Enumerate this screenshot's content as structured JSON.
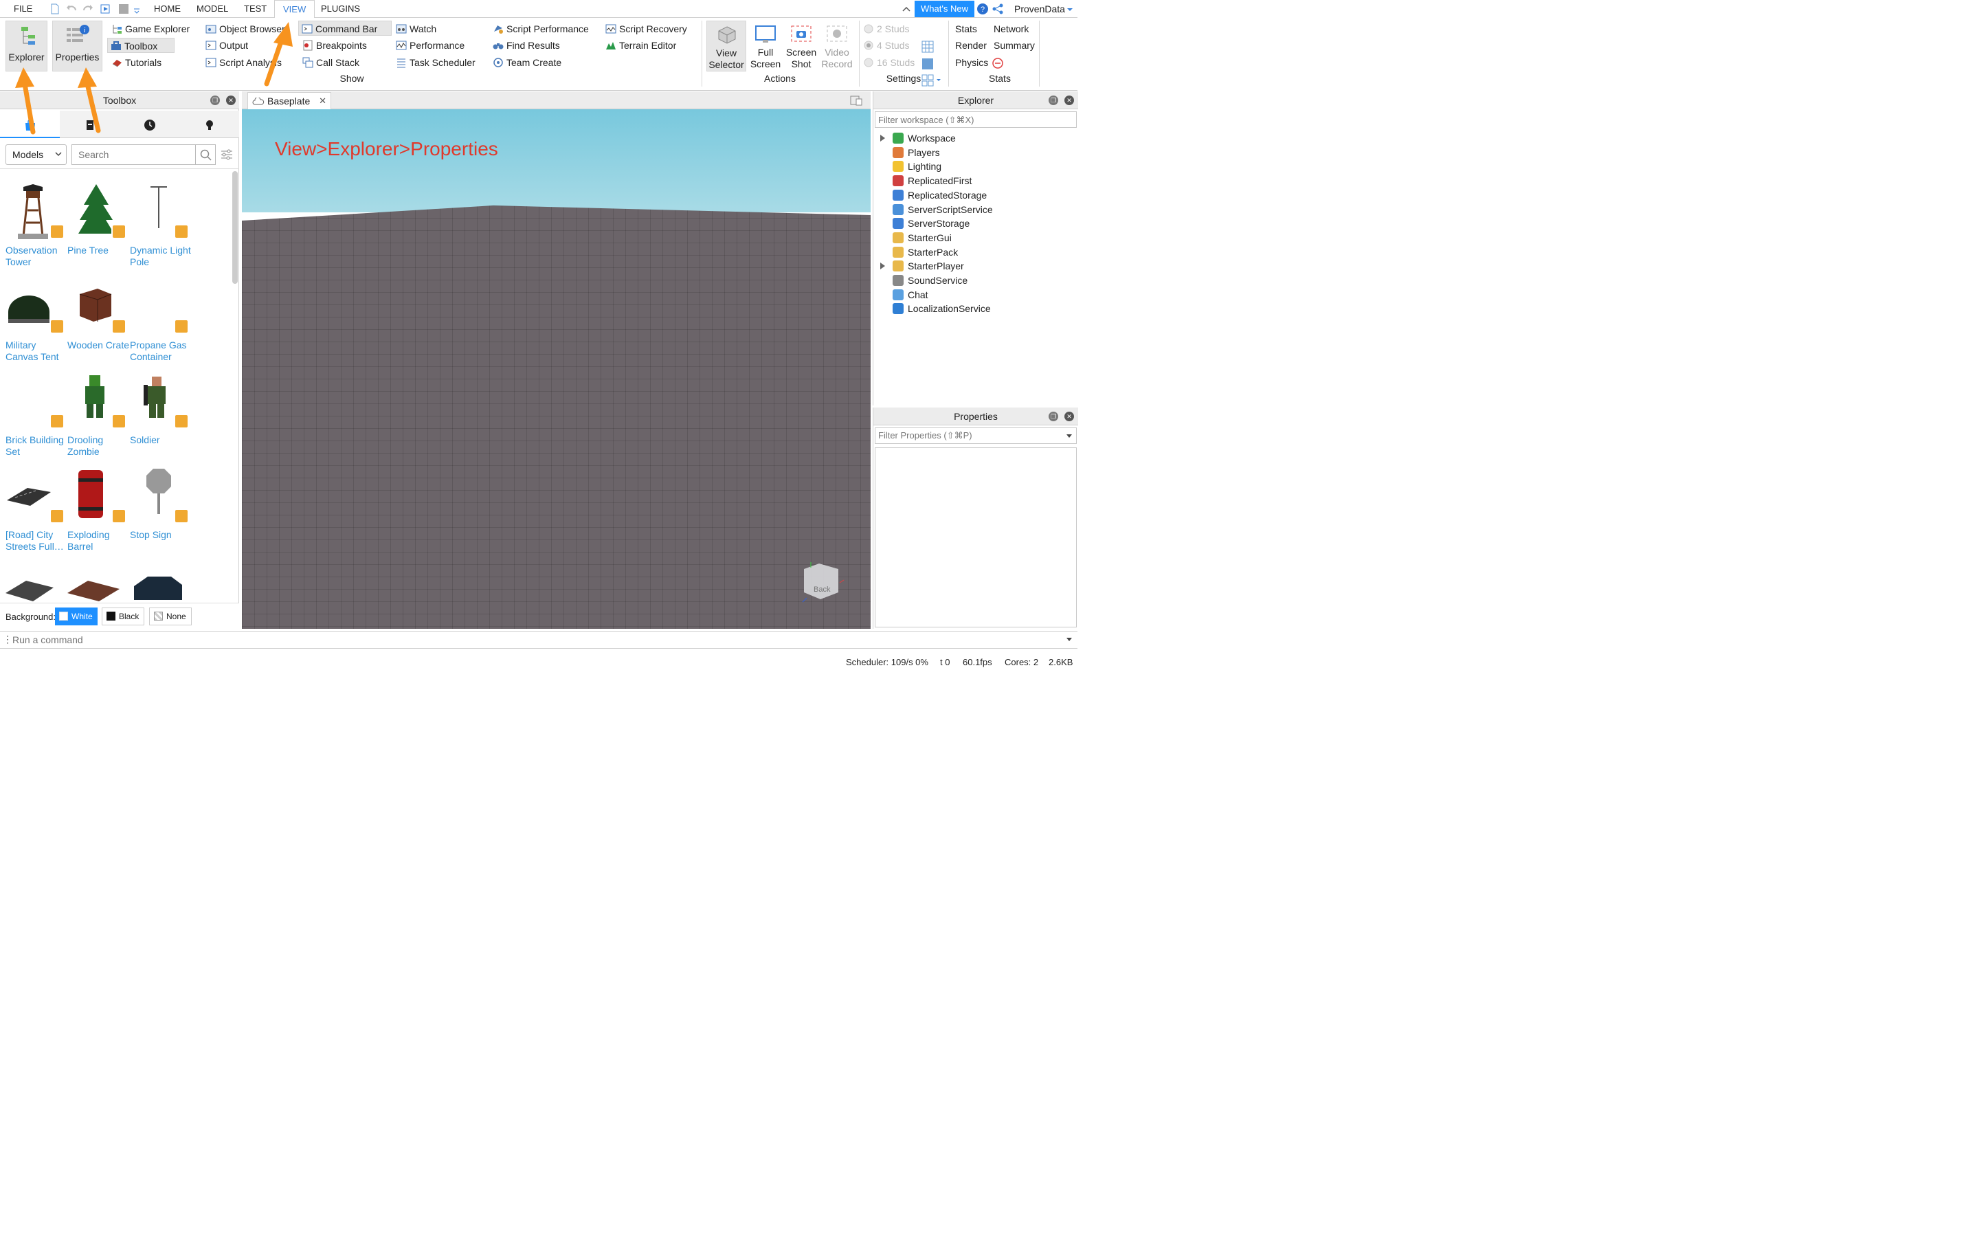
{
  "menubar": {
    "items": [
      "FILE",
      "HOME",
      "MODEL",
      "TEST",
      "VIEW",
      "PLUGINS"
    ],
    "whats_new": "What's New",
    "user": "ProvenData"
  },
  "ribbon": {
    "explorer_btn": "Explorer",
    "properties_btn": "Properties",
    "col1": [
      "Game Explorer",
      "Toolbox",
      "Tutorials"
    ],
    "col2": [
      "Object Browser",
      "Output",
      "Script Analysis"
    ],
    "col3": [
      "Command Bar",
      "Breakpoints",
      "Call Stack"
    ],
    "col4": [
      "Watch",
      "Performance",
      "Task Scheduler"
    ],
    "col5": [
      "Script Performance",
      "Find Results",
      "Team Create"
    ],
    "col6": [
      "Script Recovery",
      "Terrain Editor"
    ],
    "show_label": "Show",
    "actions": {
      "view_selector": [
        "View",
        "Selector"
      ],
      "full_screen": [
        "Full",
        "Screen"
      ],
      "screen_shot": [
        "Screen",
        "Shot"
      ],
      "video_record": [
        "Video",
        "Record"
      ],
      "label": "Actions"
    },
    "settings": {
      "studs": [
        "2 Studs",
        "4 Studs",
        "16 Studs"
      ],
      "label": "Settings"
    },
    "stats": {
      "items": [
        "Stats",
        "Network",
        "Render",
        "Summary",
        "Physics"
      ],
      "label": "Stats"
    }
  },
  "toolbox": {
    "title": "Toolbox",
    "category": "Models",
    "search_placeholder": "Search",
    "items": [
      {
        "name": "Observation Tower"
      },
      {
        "name": "Pine Tree"
      },
      {
        "name": "Dynamic Light Pole"
      },
      {
        "name": "Military Canvas Tent"
      },
      {
        "name": "Wooden Crate"
      },
      {
        "name": "Propane Gas Container"
      },
      {
        "name": "Brick Building Set"
      },
      {
        "name": "Drooling Zombie"
      },
      {
        "name": "Soldier"
      },
      {
        "name": "[Road] City Streets Full…"
      },
      {
        "name": "Exploding Barrel"
      },
      {
        "name": "Stop Sign"
      }
    ],
    "background_label": "Background:",
    "bg_options": [
      "White",
      "Black",
      "None"
    ]
  },
  "viewport": {
    "tab": "Baseplate",
    "annotation": "View>Explorer>Properties",
    "gizmo_label": "Back"
  },
  "explorer": {
    "title": "Explorer",
    "filter_placeholder": "Filter workspace (⇧⌘X)",
    "items": [
      "Workspace",
      "Players",
      "Lighting",
      "ReplicatedFirst",
      "ReplicatedStorage",
      "ServerScriptService",
      "ServerStorage",
      "StarterGui",
      "StarterPack",
      "StarterPlayer",
      "SoundService",
      "Chat",
      "LocalizationService"
    ],
    "icon_colors": [
      "#3aa84f",
      "#e07a3a",
      "#f2c230",
      "#d04040",
      "#3d7fd6",
      "#4a90d9",
      "#3d7fd6",
      "#e8b84a",
      "#e8b84a",
      "#e8b84a",
      "#888888",
      "#5aa0e0",
      "#2f7fd4"
    ]
  },
  "properties": {
    "title": "Properties",
    "filter_placeholder": "Filter Properties (⇧⌘P)"
  },
  "command_bar": {
    "placeholder": "Run a command"
  },
  "status": {
    "scheduler": "Scheduler: 109/s 0%",
    "t": "t 0",
    "fps": "60.1fps",
    "cores": "Cores: 2",
    "size": "2.6KB"
  }
}
